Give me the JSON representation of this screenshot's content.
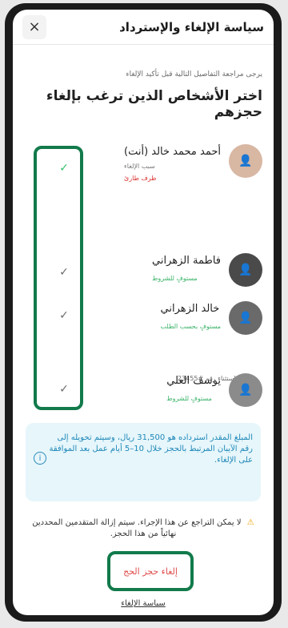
{
  "header": {
    "title": "سياسة الإلغاء والإسترداد",
    "close_icon": "×"
  },
  "intro": {
    "subtitle": "يرجى مراجعة التفاصيل التالية قبل تأكيد الإلغاء",
    "heading": "اختر الأشخاص الذين ترغب بإلغاء حجزهم"
  },
  "people": [
    {
      "name": "أحمد محمد خالد (أنت)",
      "sub": "سبب الإلغاء",
      "note": "ظرف طارئ",
      "check": "✓",
      "check_color": "#35c06c"
    },
    {
      "name": "فاطمة الزهراني",
      "sub": "مستوفٍ للشروط",
      "check": "✓",
      "check_color": "#6b6b6b"
    },
    {
      "name": "خالد الزهراني",
      "sub": "مستوفٍ بحسب الطلب",
      "check": "✓",
      "check_color": "#6b6b6b"
    },
    {
      "name": "يوسف العلي",
      "sub": "مستوفٍ للشروط",
      "check": "✓",
      "check_color": "#6b6b6b"
    }
  ],
  "request": "طلب استثناء رقم #23455",
  "info": {
    "text": "المبلغ المقدر استرداده هو 31,500 ريال، وسيتم تحويله إلى رقم الآيبان المرتبط بالحجز خلال 10–5 أيام عمل بعد الموافقة على الإلغاء.",
    "icon": "i"
  },
  "warning": {
    "text": "لا يمكن التراجع عن هذا الإجراء. سيتم إزالة المتقدمين المحددين نهائياً من هذا الحجز.",
    "icon": "⚠"
  },
  "actions": {
    "cancel": "إلغاء حجز الحج",
    "policy": "سياسة الإلغاء"
  }
}
